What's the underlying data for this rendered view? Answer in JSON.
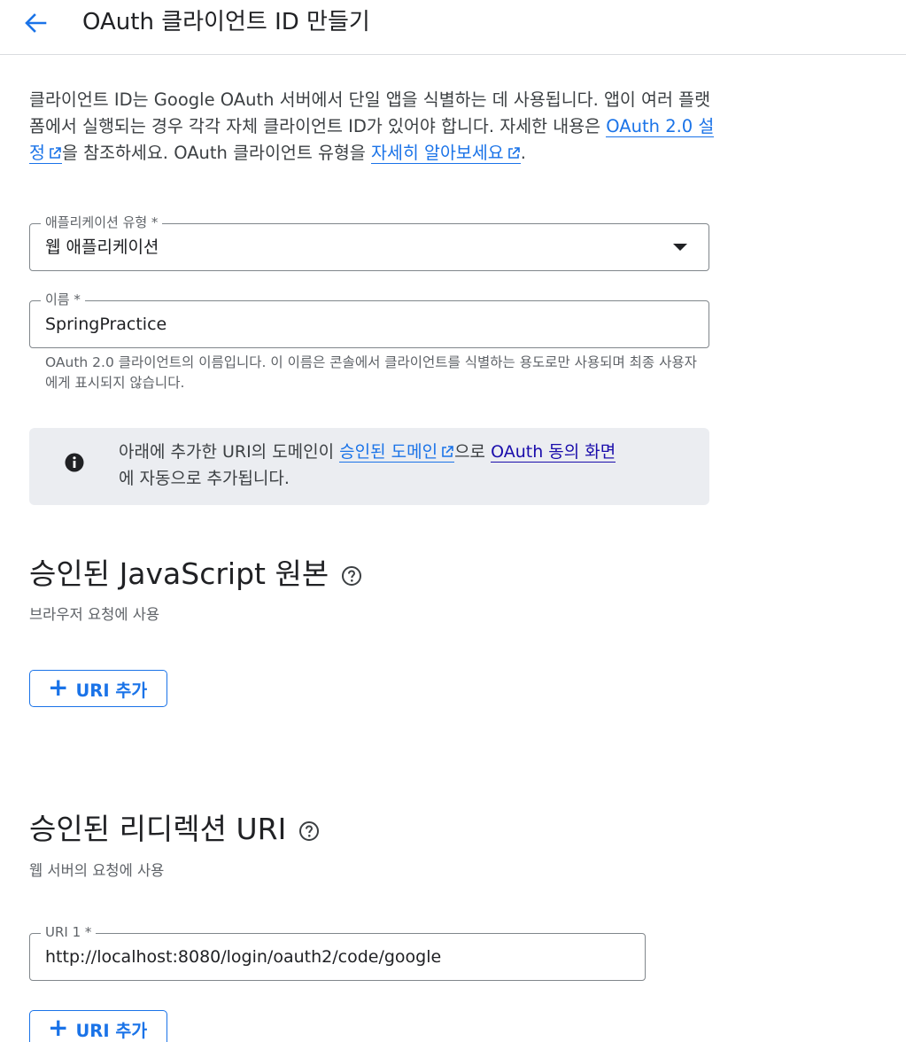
{
  "header": {
    "title": "OAuth 클라이언트 ID 만들기",
    "back_icon": "arrow-back-icon"
  },
  "intro": {
    "text_1": "클라이언트 ID는 Google OAuth 서버에서 단일 앱을 식별하는 데 사용됩니다. 앱이 여러 플랫폼에서 실행되는 경우 각각 자체 클라이언트 ID가 있어야 합니다. 자세한 내용은 ",
    "link_1": "OAuth 2.0 설정",
    "text_2": "을 참조하세요. OAuth 클라이언트 유형을 ",
    "link_2": "자세히 알아보세요",
    "text_3": "."
  },
  "app_type": {
    "label": "애플리케이션 유형 *",
    "value": "웹 애플리케이션"
  },
  "name_field": {
    "label": "이름 *",
    "value": "SpringPractice",
    "helper": "OAuth 2.0 클라이언트의 이름입니다. 이 이름은 콘솔에서 클라이언트를 식별하는 용도로만 사용되며 최종 사용자에게 표시되지 않습니다."
  },
  "info_box": {
    "text_1": "아래에 추가한 URI의 도메인이 ",
    "link_1": "승인된 도메인",
    "text_2": "으로 ",
    "link_2": "OAuth 동의 화면",
    "text_3": "에 자동으로 추가됩니다."
  },
  "js_origins": {
    "title": "승인된 JavaScript 원본",
    "subtitle": "브라우저 요청에 사용",
    "add_button": "URI 추가"
  },
  "redirect_uris": {
    "title": "승인된 리디렉션 URI",
    "subtitle": "웹 서버의 요청에 사용",
    "uri_1_label": "URI 1 *",
    "uri_1_value": "http://localhost:8080/login/oauth2/code/google",
    "add_button": "URI 추가"
  },
  "colors": {
    "accent": "#1a73e8",
    "link_visited": "#1a0dab",
    "info_bg": "#ebedf1"
  }
}
